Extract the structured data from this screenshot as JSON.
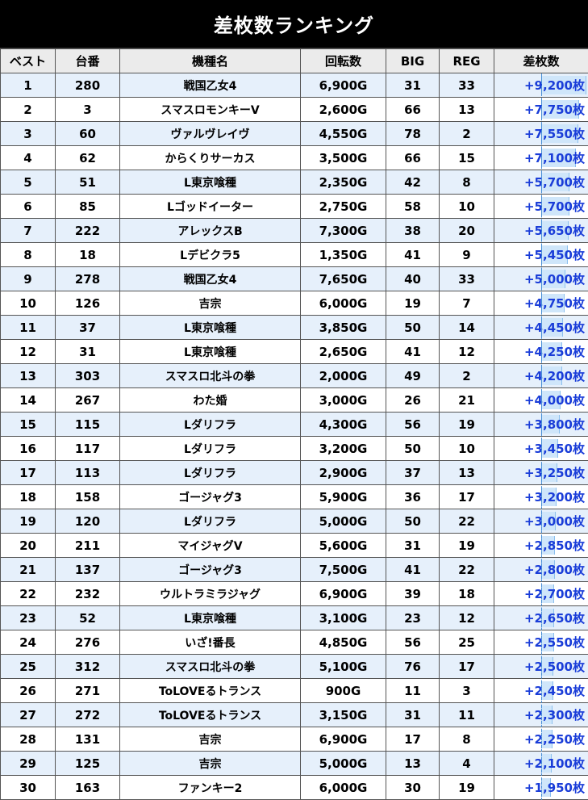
{
  "title": "差枚数ランキング",
  "headers": {
    "rank": "ベスト",
    "machine_no": "台番",
    "model": "機種名",
    "spins": "回転数",
    "big": "BIG",
    "reg": "REG",
    "diff": "差枚数"
  },
  "rows": [
    {
      "rank": "1",
      "no": "280",
      "model": "戦国乙女4",
      "spins": "6,900G",
      "big": "31",
      "reg": "33",
      "diff": "+9,200枚",
      "diff_value": 9200
    },
    {
      "rank": "2",
      "no": "3",
      "model": "スマスロモンキーV",
      "spins": "2,600G",
      "big": "66",
      "reg": "13",
      "diff": "+7,750枚",
      "diff_value": 7750
    },
    {
      "rank": "3",
      "no": "60",
      "model": "ヴァルヴレイヴ",
      "spins": "4,550G",
      "big": "78",
      "reg": "2",
      "diff": "+7,550枚",
      "diff_value": 7550
    },
    {
      "rank": "4",
      "no": "62",
      "model": "からくりサーカス",
      "spins": "3,500G",
      "big": "66",
      "reg": "15",
      "diff": "+7,100枚",
      "diff_value": 7100
    },
    {
      "rank": "5",
      "no": "51",
      "model": "L東京喰種",
      "spins": "2,350G",
      "big": "42",
      "reg": "8",
      "diff": "+5,700枚",
      "diff_value": 5700
    },
    {
      "rank": "6",
      "no": "85",
      "model": "Lゴッドイーター",
      "spins": "2,750G",
      "big": "58",
      "reg": "10",
      "diff": "+5,700枚",
      "diff_value": 5700
    },
    {
      "rank": "7",
      "no": "222",
      "model": "アレックスB",
      "spins": "7,300G",
      "big": "38",
      "reg": "20",
      "diff": "+5,650枚",
      "diff_value": 5650
    },
    {
      "rank": "8",
      "no": "18",
      "model": "Lデビクラ5",
      "spins": "1,350G",
      "big": "41",
      "reg": "9",
      "diff": "+5,450枚",
      "diff_value": 5450
    },
    {
      "rank": "9",
      "no": "278",
      "model": "戦国乙女4",
      "spins": "7,650G",
      "big": "40",
      "reg": "33",
      "diff": "+5,000枚",
      "diff_value": 5000
    },
    {
      "rank": "10",
      "no": "126",
      "model": "吉宗",
      "spins": "6,000G",
      "big": "19",
      "reg": "7",
      "diff": "+4,750枚",
      "diff_value": 4750
    },
    {
      "rank": "11",
      "no": "37",
      "model": "L東京喰種",
      "spins": "3,850G",
      "big": "50",
      "reg": "14",
      "diff": "+4,450枚",
      "diff_value": 4450
    },
    {
      "rank": "12",
      "no": "31",
      "model": "L東京喰種",
      "spins": "2,650G",
      "big": "41",
      "reg": "12",
      "diff": "+4,250枚",
      "diff_value": 4250
    },
    {
      "rank": "13",
      "no": "303",
      "model": "スマスロ北斗の拳",
      "spins": "2,000G",
      "big": "49",
      "reg": "2",
      "diff": "+4,200枚",
      "diff_value": 4200
    },
    {
      "rank": "14",
      "no": "267",
      "model": "わた婚",
      "spins": "3,000G",
      "big": "26",
      "reg": "21",
      "diff": "+4,000枚",
      "diff_value": 4000
    },
    {
      "rank": "15",
      "no": "115",
      "model": "Lダリフラ",
      "spins": "4,300G",
      "big": "56",
      "reg": "19",
      "diff": "+3,800枚",
      "diff_value": 3800
    },
    {
      "rank": "16",
      "no": "117",
      "model": "Lダリフラ",
      "spins": "3,200G",
      "big": "50",
      "reg": "10",
      "diff": "+3,450枚",
      "diff_value": 3450
    },
    {
      "rank": "17",
      "no": "113",
      "model": "Lダリフラ",
      "spins": "2,900G",
      "big": "37",
      "reg": "13",
      "diff": "+3,250枚",
      "diff_value": 3250
    },
    {
      "rank": "18",
      "no": "158",
      "model": "ゴージャグ3",
      "spins": "5,900G",
      "big": "36",
      "reg": "17",
      "diff": "+3,200枚",
      "diff_value": 3200
    },
    {
      "rank": "19",
      "no": "120",
      "model": "Lダリフラ",
      "spins": "5,000G",
      "big": "50",
      "reg": "22",
      "diff": "+3,000枚",
      "diff_value": 3000
    },
    {
      "rank": "20",
      "no": "211",
      "model": "マイジャグV",
      "spins": "5,600G",
      "big": "31",
      "reg": "19",
      "diff": "+2,850枚",
      "diff_value": 2850
    },
    {
      "rank": "21",
      "no": "137",
      "model": "ゴージャグ3",
      "spins": "7,500G",
      "big": "41",
      "reg": "22",
      "diff": "+2,800枚",
      "diff_value": 2800
    },
    {
      "rank": "22",
      "no": "232",
      "model": "ウルトラミラジャグ",
      "spins": "6,900G",
      "big": "39",
      "reg": "18",
      "diff": "+2,700枚",
      "diff_value": 2700
    },
    {
      "rank": "23",
      "no": "52",
      "model": "L東京喰種",
      "spins": "3,100G",
      "big": "23",
      "reg": "12",
      "diff": "+2,650枚",
      "diff_value": 2650
    },
    {
      "rank": "24",
      "no": "276",
      "model": "いざ!番長",
      "spins": "4,850G",
      "big": "56",
      "reg": "25",
      "diff": "+2,550枚",
      "diff_value": 2550
    },
    {
      "rank": "25",
      "no": "312",
      "model": "スマスロ北斗の拳",
      "spins": "5,100G",
      "big": "76",
      "reg": "17",
      "diff": "+2,500枚",
      "diff_value": 2500
    },
    {
      "rank": "26",
      "no": "271",
      "model": "ToLOVEるトランス",
      "spins": "900G",
      "big": "11",
      "reg": "3",
      "diff": "+2,450枚",
      "diff_value": 2450
    },
    {
      "rank": "27",
      "no": "272",
      "model": "ToLOVEるトランス",
      "spins": "3,150G",
      "big": "31",
      "reg": "11",
      "diff": "+2,300枚",
      "diff_value": 2300
    },
    {
      "rank": "28",
      "no": "131",
      "model": "吉宗",
      "spins": "6,900G",
      "big": "17",
      "reg": "8",
      "diff": "+2,250枚",
      "diff_value": 2250
    },
    {
      "rank": "29",
      "no": "125",
      "model": "吉宗",
      "spins": "5,000G",
      "big": "13",
      "reg": "4",
      "diff": "+2,100枚",
      "diff_value": 2100
    },
    {
      "rank": "30",
      "no": "163",
      "model": "ファンキー2",
      "spins": "6,000G",
      "big": "30",
      "reg": "19",
      "diff": "+1,950枚",
      "diff_value": 1950
    }
  ],
  "colors": {
    "title_bg": "#000000",
    "title_text": "#ffffff",
    "header_bg": "#ebebeb",
    "row_alt_bg": "#e6f0fb",
    "diff_text": "#1a3dd8",
    "bar_fill": "#cfe6fa"
  }
}
